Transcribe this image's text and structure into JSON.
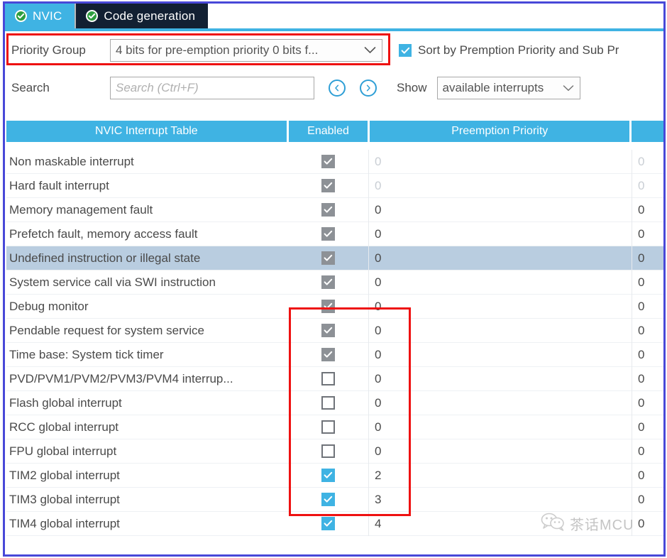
{
  "tabs": [
    {
      "label": "NVIC",
      "icon": "check-circle-icon",
      "active": true
    },
    {
      "label": "Code generation",
      "icon": "check-circle-icon",
      "active": false
    }
  ],
  "toolbar": {
    "priority_group_label": "Priority Group",
    "priority_group_value": "4 bits for pre-emption priority 0 bits f...",
    "sort_checkbox_label": "Sort by Premption Priority and Sub Pr",
    "sort_checkbox_checked": true,
    "search_label": "Search",
    "search_value": "",
    "search_placeholder": "Search (Ctrl+F)",
    "prev_button": "‹",
    "next_button": "›",
    "show_label": "Show",
    "show_value": "available interrupts"
  },
  "table": {
    "headers": [
      "NVIC Interrupt Table",
      "Enabled",
      "Preemption Priority",
      ""
    ],
    "rows": [
      {
        "name": "Non maskable interrupt",
        "enabled": "gray",
        "preemption": "0",
        "sub": "0",
        "dim": true,
        "selected": false
      },
      {
        "name": "Hard fault interrupt",
        "enabled": "gray",
        "preemption": "0",
        "sub": "0",
        "dim": true,
        "selected": false
      },
      {
        "name": "Memory management fault",
        "enabled": "gray",
        "preemption": "0",
        "sub": "0",
        "dim": false,
        "selected": false
      },
      {
        "name": "Prefetch fault, memory access fault",
        "enabled": "gray",
        "preemption": "0",
        "sub": "0",
        "dim": false,
        "selected": false
      },
      {
        "name": "Undefined instruction or illegal state",
        "enabled": "gray",
        "preemption": "0",
        "sub": "0",
        "dim": false,
        "selected": true
      },
      {
        "name": "System service call via SWI instruction",
        "enabled": "gray",
        "preemption": "0",
        "sub": "0",
        "dim": false,
        "selected": false
      },
      {
        "name": "Debug monitor",
        "enabled": "gray",
        "preemption": "0",
        "sub": "0",
        "dim": false,
        "selected": false
      },
      {
        "name": "Pendable request for system service",
        "enabled": "gray",
        "preemption": "0",
        "sub": "0",
        "dim": false,
        "selected": false
      },
      {
        "name": "Time base: System tick timer",
        "enabled": "gray",
        "preemption": "0",
        "sub": "0",
        "dim": false,
        "selected": false
      },
      {
        "name": "PVD/PVM1/PVM2/PVM3/PVM4 interrup...",
        "enabled": "empty",
        "preemption": "0",
        "sub": "0",
        "dim": false,
        "selected": false
      },
      {
        "name": "Flash global interrupt",
        "enabled": "empty",
        "preemption": "0",
        "sub": "0",
        "dim": false,
        "selected": false
      },
      {
        "name": "RCC global interrupt",
        "enabled": "empty",
        "preemption": "0",
        "sub": "0",
        "dim": false,
        "selected": false
      },
      {
        "name": "FPU global interrupt",
        "enabled": "empty",
        "preemption": "0",
        "sub": "0",
        "dim": false,
        "selected": false
      },
      {
        "name": "TIM2 global interrupt",
        "enabled": "blue",
        "preemption": "2",
        "sub": "0",
        "dim": false,
        "selected": false
      },
      {
        "name": "TIM3 global interrupt",
        "enabled": "blue",
        "preemption": "3",
        "sub": "0",
        "dim": false,
        "selected": false
      },
      {
        "name": "TIM4 global interrupt",
        "enabled": "blue",
        "preemption": "4",
        "sub": "0",
        "dim": false,
        "selected": false
      }
    ]
  },
  "watermark": {
    "text": "茶话MCU",
    "icon": "wechat-icon"
  },
  "colors": {
    "accent_blue": "#3fb3e3",
    "frame_violet": "#4848d8",
    "highlight_red": "#ee1111",
    "selected_row": "#b9cde0",
    "tab_inactive_bg": "#122033",
    "checkbox_gray": "#8d9196"
  }
}
